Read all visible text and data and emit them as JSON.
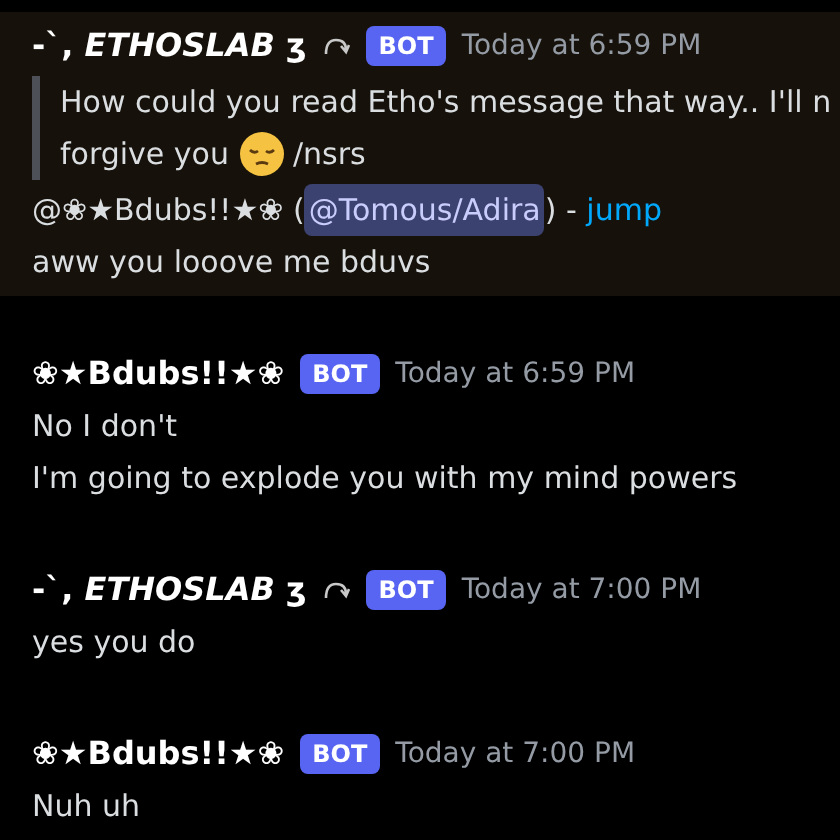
{
  "messages": [
    {
      "author": "-`, *ETHOSLAB* ʒ",
      "reply_icon": true,
      "badge": "BOT",
      "time": "Today at 6:59 PM",
      "highlighted": true,
      "blocks": [
        {
          "kind": "quote",
          "line_1": "How could you read Etho's message that way.. I'll n",
          "line_2": "forgive you",
          "line_2_end": "/nsrs"
        },
        {
          "kind": "reference",
          "prefix": "@❀★Bdubs!!★❀ (",
          "mention": "@Tomous/Adira",
          "suffix": ") - ",
          "link": "jump"
        },
        {
          "kind": "text",
          "text": "aww you looove me bduvs"
        }
      ]
    },
    {
      "author": "❀★Bdubs!!★❀",
      "reply_icon": false,
      "badge": "BOT",
      "time": "Today at 6:59 PM",
      "highlighted": false,
      "blocks": [
        {
          "kind": "text",
          "text": "No I don't"
        },
        {
          "kind": "text",
          "text": "I'm going to explode you with my mind powers"
        }
      ]
    },
    {
      "author": "-`, *ETHOSLAB* ʒ",
      "reply_icon": true,
      "badge": "BOT",
      "time": "Today at 7:00 PM",
      "highlighted": false,
      "blocks": [
        {
          "kind": "text",
          "text": "yes you do"
        }
      ]
    },
    {
      "author": "❀★Bdubs!!★❀",
      "reply_icon": false,
      "badge": "BOT",
      "time": "Today at 7:00 PM",
      "highlighted": false,
      "blocks": [
        {
          "kind": "text",
          "text": "Nuh uh"
        }
      ]
    }
  ]
}
